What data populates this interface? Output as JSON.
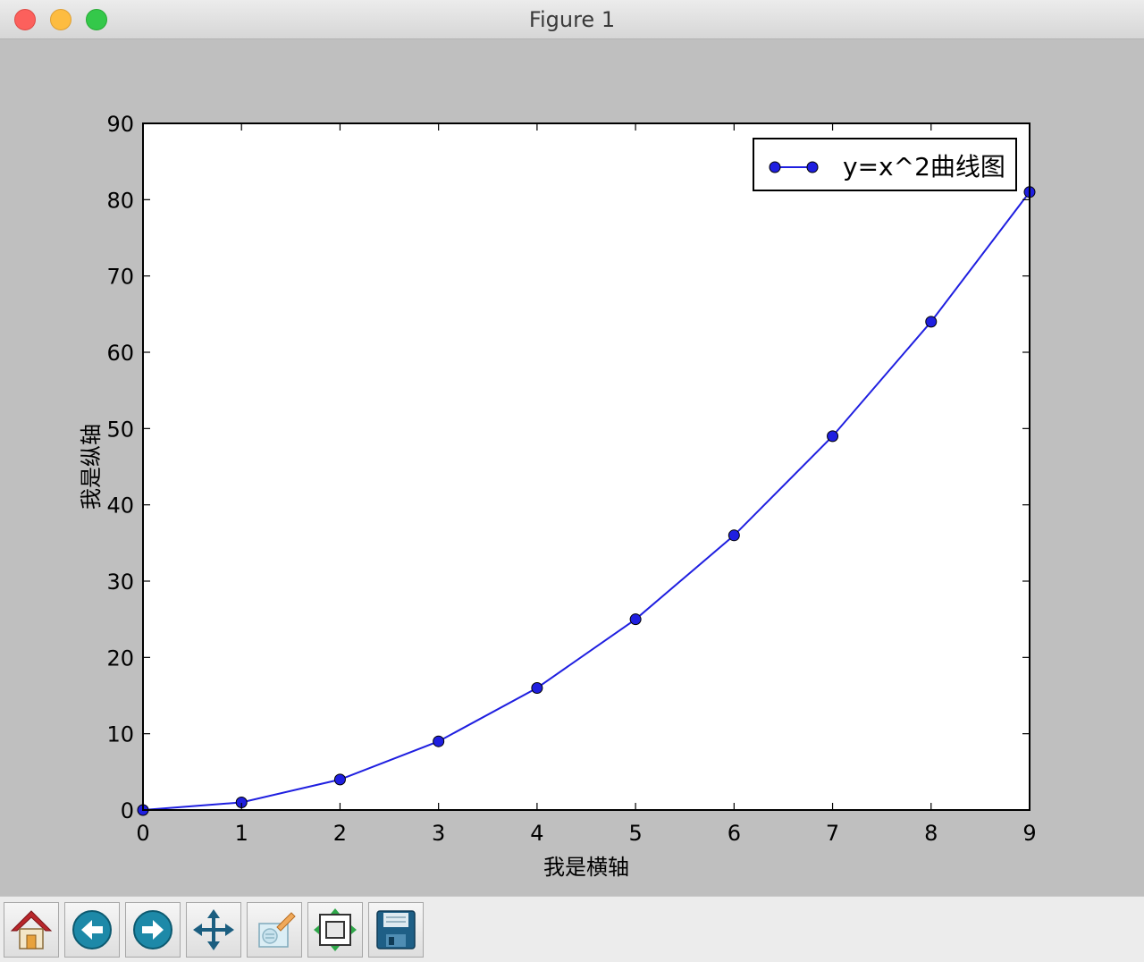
{
  "window": {
    "title": "Figure 1"
  },
  "chart_data": {
    "type": "line",
    "x": [
      0,
      1,
      2,
      3,
      4,
      5,
      6,
      7,
      8,
      9
    ],
    "series": [
      {
        "name": "y=x^2曲线图",
        "values": [
          0,
          1,
          4,
          9,
          16,
          25,
          36,
          49,
          64,
          81
        ],
        "color": "#1f1fe0",
        "marker": "circle"
      }
    ],
    "xlabel": "我是横轴",
    "ylabel": "我是纵轴",
    "xlim": [
      0,
      9
    ],
    "ylim": [
      0,
      90
    ],
    "xticks": [
      0,
      1,
      2,
      3,
      4,
      5,
      6,
      7,
      8,
      9
    ],
    "yticks": [
      0,
      10,
      20,
      30,
      40,
      50,
      60,
      70,
      80,
      90
    ],
    "grid": false,
    "legend": "top-right"
  },
  "toolbar": {
    "buttons": [
      {
        "icon": "home-icon"
      },
      {
        "icon": "back-icon"
      },
      {
        "icon": "forward-icon"
      },
      {
        "icon": "pan-icon"
      },
      {
        "icon": "zoom-icon"
      },
      {
        "icon": "subplots-icon"
      },
      {
        "icon": "save-icon"
      }
    ]
  }
}
